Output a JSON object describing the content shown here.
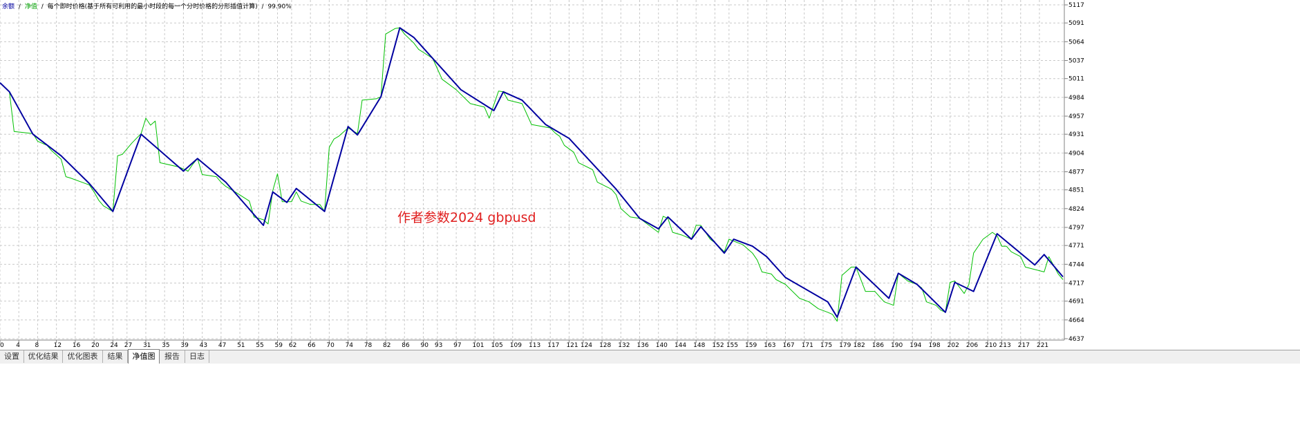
{
  "header": {
    "part_all": "余额",
    "sep1": "/",
    "part_equity": "净值",
    "sep2": "/",
    "description": "每个即时价格(基于所有可利用的最小时段的每一个分时价格的分形插值计算)",
    "sep3": "/",
    "quality": "99.90%"
  },
  "watermark": "作者参数2024 gbpusd",
  "tabs": [
    {
      "label": "设置"
    },
    {
      "label": "优化结果"
    },
    {
      "label": "优化图表"
    },
    {
      "label": "结果"
    },
    {
      "label": "净值图"
    },
    {
      "label": "报告"
    },
    {
      "label": "日志"
    }
  ],
  "colors": {
    "balance": "#0000a0",
    "equity": "#00c000",
    "grid": "#c8c8c8",
    "watermark": "#e02020"
  },
  "chart_data": {
    "type": "line",
    "x_ticks": [
      0,
      4,
      8,
      12,
      16,
      20,
      24,
      27,
      31,
      35,
      39,
      43,
      47,
      51,
      55,
      59,
      62,
      66,
      70,
      74,
      78,
      82,
      86,
      90,
      93,
      97,
      101,
      105,
      109,
      113,
      117,
      121,
      124,
      128,
      132,
      136,
      140,
      144,
      148,
      152,
      155,
      159,
      163,
      167,
      171,
      175,
      179,
      182,
      186,
      190,
      194,
      198,
      202,
      206,
      210,
      213,
      217,
      221
    ],
    "y_ticks": [
      5117,
      5091,
      5064,
      5037,
      5011,
      4984,
      4957,
      4931,
      4904,
      4877,
      4851,
      4824,
      4797,
      4771,
      4744,
      4717,
      4691,
      4664,
      4637
    ],
    "xlim": [
      0,
      226
    ],
    "ylim": [
      4637,
      5124
    ],
    "grid": true,
    "series": [
      {
        "name": "余额",
        "color": "#0000a0",
        "points": [
          [
            0,
            5005
          ],
          [
            2,
            4992
          ],
          [
            7,
            4931
          ],
          [
            13,
            4900
          ],
          [
            19,
            4860
          ],
          [
            24,
            4820
          ],
          [
            30,
            4931
          ],
          [
            39,
            4878
          ],
          [
            42,
            4896
          ],
          [
            48,
            4862
          ],
          [
            56,
            4800
          ],
          [
            58,
            4848
          ],
          [
            61,
            4833
          ],
          [
            63,
            4853
          ],
          [
            69,
            4820
          ],
          [
            74,
            4942
          ],
          [
            76,
            4930
          ],
          [
            81,
            4985
          ],
          [
            85,
            5084
          ],
          [
            88,
            5070
          ],
          [
            94,
            5025
          ],
          [
            98,
            4995
          ],
          [
            105,
            4965
          ],
          [
            107,
            4992
          ],
          [
            111,
            4980
          ],
          [
            116,
            4945
          ],
          [
            121,
            4925
          ],
          [
            131,
            4852
          ],
          [
            136,
            4810
          ],
          [
            140,
            4795
          ],
          [
            142,
            4812
          ],
          [
            147,
            4780
          ],
          [
            149,
            4798
          ],
          [
            154,
            4760
          ],
          [
            156,
            4780
          ],
          [
            160,
            4770
          ],
          [
            163,
            4755
          ],
          [
            167,
            4725
          ],
          [
            176,
            4690
          ],
          [
            178,
            4668
          ],
          [
            182,
            4740
          ],
          [
            189,
            4695
          ],
          [
            191,
            4731
          ],
          [
            195,
            4715
          ],
          [
            201,
            4675
          ],
          [
            203,
            4718
          ],
          [
            207,
            4705
          ],
          [
            212,
            4788
          ],
          [
            220,
            4743
          ],
          [
            222,
            4758
          ],
          [
            226,
            4726
          ]
        ]
      },
      {
        "name": "净值",
        "color": "#00c000",
        "points": [
          [
            0,
            5005
          ],
          [
            2,
            4992
          ],
          [
            3,
            4935
          ],
          [
            7,
            4932
          ],
          [
            8,
            4921
          ],
          [
            10,
            4915
          ],
          [
            11,
            4907
          ],
          [
            13,
            4895
          ],
          [
            14,
            4870
          ],
          [
            15,
            4868
          ],
          [
            19,
            4858
          ],
          [
            20,
            4848
          ],
          [
            21,
            4836
          ],
          [
            22,
            4828
          ],
          [
            24,
            4820
          ],
          [
            25,
            4900
          ],
          [
            26,
            4902
          ],
          [
            28,
            4918
          ],
          [
            30,
            4932
          ],
          [
            31,
            4954
          ],
          [
            32,
            4944
          ],
          [
            33,
            4950
          ],
          [
            34,
            4890
          ],
          [
            38,
            4884
          ],
          [
            40,
            4878
          ],
          [
            41,
            4888
          ],
          [
            42,
            4896
          ],
          [
            43,
            4873
          ],
          [
            46,
            4870
          ],
          [
            47,
            4862
          ],
          [
            48,
            4856
          ],
          [
            50,
            4848
          ],
          [
            53,
            4835
          ],
          [
            54,
            4812
          ],
          [
            56,
            4808
          ],
          [
            57,
            4802
          ],
          [
            58,
            4850
          ],
          [
            59,
            4874
          ],
          [
            60,
            4834
          ],
          [
            62,
            4834
          ],
          [
            63,
            4848
          ],
          [
            64,
            4835
          ],
          [
            66,
            4830
          ],
          [
            68,
            4830
          ],
          [
            69,
            4820
          ],
          [
            70,
            4912
          ],
          [
            71,
            4924
          ],
          [
            72,
            4928
          ],
          [
            74,
            4940
          ],
          [
            76,
            4932
          ],
          [
            77,
            4980
          ],
          [
            80,
            4982
          ],
          [
            81,
            4985
          ],
          [
            82,
            5075
          ],
          [
            84,
            5083
          ],
          [
            85,
            5084
          ],
          [
            86,
            5075
          ],
          [
            88,
            5062
          ],
          [
            89,
            5053
          ],
          [
            92,
            5040
          ],
          [
            94,
            5010
          ],
          [
            95,
            5005
          ],
          [
            97,
            4995
          ],
          [
            100,
            4975
          ],
          [
            103,
            4970
          ],
          [
            104,
            4954
          ],
          [
            106,
            4993
          ],
          [
            107,
            4992
          ],
          [
            108,
            4980
          ],
          [
            111,
            4975
          ],
          [
            113,
            4945
          ],
          [
            117,
            4940
          ],
          [
            118,
            4933
          ],
          [
            119,
            4928
          ],
          [
            120,
            4915
          ],
          [
            122,
            4905
          ],
          [
            123,
            4890
          ],
          [
            126,
            4880
          ],
          [
            127,
            4862
          ],
          [
            130,
            4852
          ],
          [
            131,
            4844
          ],
          [
            132,
            4824
          ],
          [
            134,
            4812
          ],
          [
            136,
            4810
          ],
          [
            138,
            4800
          ],
          [
            140,
            4790
          ],
          [
            141,
            4813
          ],
          [
            142,
            4810
          ],
          [
            143,
            4790
          ],
          [
            145,
            4786
          ],
          [
            147,
            4780
          ],
          [
            148,
            4800
          ],
          [
            149,
            4800
          ],
          [
            151,
            4780
          ],
          [
            152,
            4775
          ],
          [
            154,
            4762
          ],
          [
            155,
            4780
          ],
          [
            158,
            4772
          ],
          [
            160,
            4760
          ],
          [
            161,
            4750
          ],
          [
            162,
            4733
          ],
          [
            164,
            4730
          ],
          [
            165,
            4722
          ],
          [
            167,
            4715
          ],
          [
            170,
            4695
          ],
          [
            172,
            4690
          ],
          [
            174,
            4680
          ],
          [
            176,
            4675
          ],
          [
            177,
            4672
          ],
          [
            178,
            4662
          ],
          [
            179,
            4728
          ],
          [
            181,
            4740
          ],
          [
            182,
            4740
          ],
          [
            184,
            4705
          ],
          [
            186,
            4705
          ],
          [
            188,
            4690
          ],
          [
            190,
            4685
          ],
          [
            191,
            4731
          ],
          [
            193,
            4720
          ],
          [
            195,
            4715
          ],
          [
            196,
            4710
          ],
          [
            197,
            4690
          ],
          [
            199,
            4685
          ],
          [
            200,
            4678
          ],
          [
            201,
            4675
          ],
          [
            202,
            4718
          ],
          [
            203,
            4720
          ],
          [
            205,
            4702
          ],
          [
            206,
            4715
          ],
          [
            207,
            4760
          ],
          [
            209,
            4780
          ],
          [
            211,
            4790
          ],
          [
            212,
            4785
          ],
          [
            213,
            4770
          ],
          [
            214,
            4770
          ],
          [
            215,
            4762
          ],
          [
            217,
            4755
          ],
          [
            218,
            4740
          ],
          [
            222,
            4733
          ],
          [
            223,
            4755
          ],
          [
            225,
            4730
          ],
          [
            226,
            4722
          ]
        ]
      }
    ]
  }
}
